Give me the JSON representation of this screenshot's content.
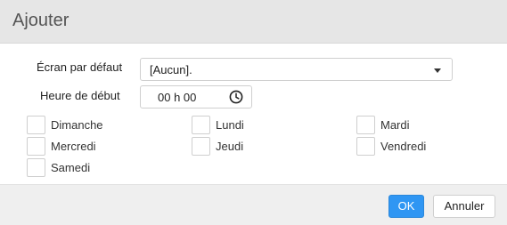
{
  "dialog": {
    "title": "Ajouter"
  },
  "form": {
    "default_screen": {
      "label": "Écran par défaut",
      "value": "[Aucun]."
    },
    "start_time": {
      "label": "Heure de début",
      "value": "00 h 00"
    }
  },
  "days": [
    {
      "label": "Dimanche",
      "checked": false
    },
    {
      "label": "Lundi",
      "checked": false
    },
    {
      "label": "Mardi",
      "checked": false
    },
    {
      "label": "Mercredi",
      "checked": false
    },
    {
      "label": "Jeudi",
      "checked": false
    },
    {
      "label": "Vendredi",
      "checked": false
    },
    {
      "label": "Samedi",
      "checked": false
    }
  ],
  "buttons": {
    "ok_label": "OK",
    "cancel_label": "Annuler"
  },
  "colors": {
    "primary": "#2f96f3",
    "header_bg": "#e6e6e6",
    "footer_bg": "#efefef"
  }
}
